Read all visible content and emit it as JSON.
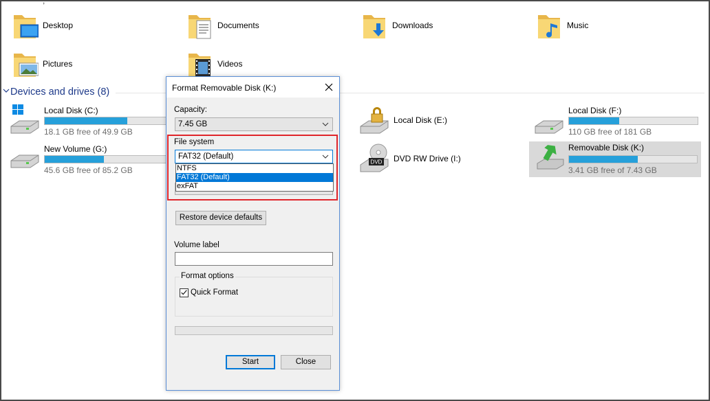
{
  "folders": [
    {
      "label": "Desktop",
      "icon": "desktop-folder-icon"
    },
    {
      "label": "Documents",
      "icon": "documents-folder-icon"
    },
    {
      "label": "Downloads",
      "icon": "downloads-folder-icon"
    },
    {
      "label": "Music",
      "icon": "music-folder-icon"
    },
    {
      "label": "Pictures",
      "icon": "pictures-folder-icon"
    },
    {
      "label": "Videos",
      "icon": "videos-folder-icon"
    }
  ],
  "devices": {
    "title": "Devices and drives (8)",
    "drives": [
      {
        "name": "Local Disk (C:)",
        "free": "18.1 GB free of 49.9 GB",
        "used_fraction": 0.64
      },
      {
        "name": "New Volume (G:)",
        "free": "45.6 GB free of 85.2 GB",
        "used_fraction": 0.46
      },
      {
        "name": "Local Disk (E:)"
      },
      {
        "name": "DVD RW Drive (I:)",
        "icon_text": "DVD"
      },
      {
        "name": "Local Disk (F:)",
        "free": "110 GB free of 181 GB",
        "used_fraction": 0.39
      },
      {
        "name": "Removable Disk (K:)",
        "free": "3.41 GB free of 7.43 GB",
        "used_fraction": 0.54
      }
    ]
  },
  "dialog": {
    "title": "Format Removable Disk (K:)",
    "capacity_label": "Capacity:",
    "capacity_value": "7.45 GB",
    "filesystem_label": "File system",
    "filesystem_value": "FAT32 (Default)",
    "filesystem_options": [
      "NTFS",
      "FAT32 (Default)",
      "exFAT"
    ],
    "restore_label": "Restore device defaults",
    "volume_label": "Volume label",
    "volume_value": "",
    "format_options_label": "Format options",
    "quick_format_label": "Quick Format",
    "quick_format_checked": true,
    "start_label": "Start",
    "close_label": "Close"
  },
  "colors": {
    "accent": "#0078d7",
    "bar_fill": "#26a0da",
    "highlight": "#e0242a"
  }
}
